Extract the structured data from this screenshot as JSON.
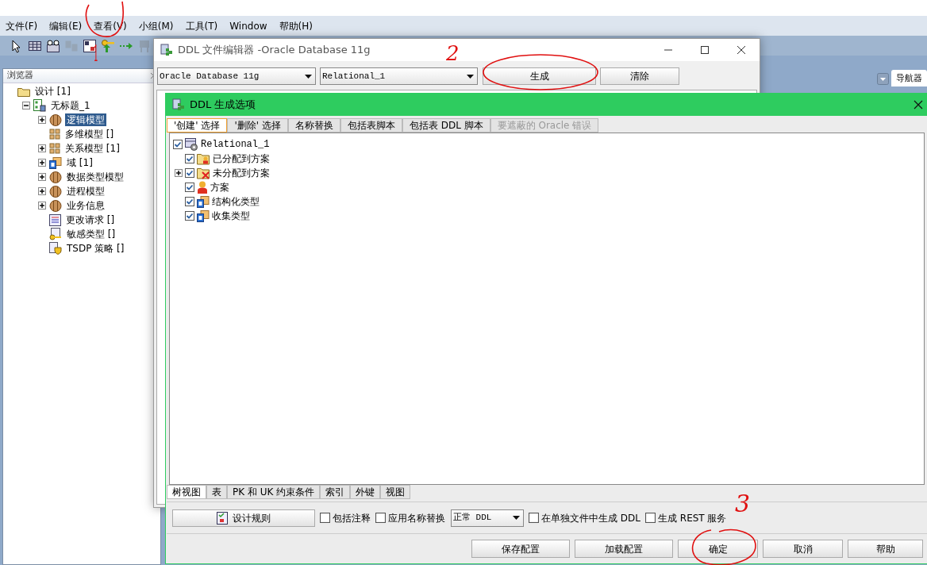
{
  "menu": [
    {
      "label": "文件(F)"
    },
    {
      "label": "编辑(E)"
    },
    {
      "label": "查看(V)"
    },
    {
      "label": "小组(M)"
    },
    {
      "label": "工具(T)"
    },
    {
      "label": "Window"
    },
    {
      "label": "帮助(H)"
    }
  ],
  "toolbar": [
    {
      "kind": "pointer",
      "disabled": false
    },
    {
      "kind": "table",
      "disabled": false
    },
    {
      "kind": "view",
      "disabled": false
    },
    {
      "kind": "split",
      "disabled": true
    },
    {
      "kind": "merge",
      "disabled": false
    },
    {
      "kind": "key",
      "disabled": false
    },
    {
      "kind": "arrow",
      "disabled": false
    },
    {
      "kind": "stool",
      "disabled": true
    }
  ],
  "browser": {
    "title": "浏览器",
    "tree": [
      {
        "label": "设计 [1]",
        "kind": "folder",
        "toggle": false,
        "selected": false,
        "children": [
          {
            "label": "无标题_1",
            "kind": "model",
            "toggle": true,
            "expanded": true,
            "selected": false,
            "children": [
              {
                "label": "逻辑模型",
                "kind": "cube",
                "toggle": true,
                "expanded": false,
                "selected": true
              },
              {
                "label": "多维模型 []",
                "kind": "grid",
                "toggle": false,
                "selected": false
              },
              {
                "label": "关系模型 [1]",
                "kind": "grid",
                "toggle": true,
                "expanded": false,
                "selected": false
              },
              {
                "label": "域 [1]",
                "kind": "domain",
                "toggle": true,
                "expanded": false,
                "selected": false
              },
              {
                "label": "数据类型模型",
                "kind": "cube",
                "toggle": true,
                "expanded": false,
                "selected": false
              },
              {
                "label": "进程模型",
                "kind": "cube",
                "toggle": true,
                "expanded": false,
                "selected": false
              },
              {
                "label": "业务信息",
                "kind": "cube",
                "toggle": true,
                "expanded": false,
                "selected": false
              },
              {
                "label": "更改请求 []",
                "kind": "list",
                "toggle": false,
                "selected": false
              },
              {
                "label": "敏感类型 []",
                "kind": "keydoc",
                "toggle": false,
                "selected": false
              },
              {
                "label": "TSDP 策略 []",
                "kind": "shielddoc",
                "toggle": false,
                "selected": false
              }
            ]
          }
        ]
      }
    ]
  },
  "navigator_tab": {
    "label": "导航器"
  },
  "editor": {
    "title": "DDL 文件编辑器 -Oracle Database 11g",
    "database_select": "Oracle Database 11g",
    "model_select": "Relational_1",
    "buttons": [
      {
        "label": "生成"
      },
      {
        "label": "清除"
      }
    ]
  },
  "dialog": {
    "title": "DDL 生成选项",
    "tabs": [
      {
        "label": "'创建' 选择",
        "selected": true,
        "disabled": false
      },
      {
        "label": "'删除' 选择",
        "selected": false,
        "disabled": false
      },
      {
        "label": "名称替换",
        "selected": false,
        "disabled": false
      },
      {
        "label": "包括表脚本",
        "selected": false,
        "disabled": false
      },
      {
        "label": "包括表 DDL 脚本",
        "selected": false,
        "disabled": false
      },
      {
        "label": "要遮蔽的 Oracle 错误",
        "selected": false,
        "disabled": true
      }
    ],
    "tree": [
      {
        "label": "Relational_1",
        "kind": "schema",
        "checked": true,
        "children": [
          {
            "label": "已分配到方案",
            "kind": "folder-user",
            "checked": true,
            "toggle": false
          },
          {
            "label": "未分配到方案",
            "kind": "folder-cross",
            "checked": true,
            "toggle": true,
            "expanded": false
          },
          {
            "label": "方案",
            "kind": "user",
            "checked": true,
            "toggle": false
          },
          {
            "label": "结构化类型",
            "kind": "folder-type",
            "checked": true,
            "toggle": false
          },
          {
            "label": "收集类型",
            "kind": "folder-type",
            "checked": true,
            "toggle": false
          }
        ]
      }
    ],
    "view_tabs": [
      {
        "label": "树视图",
        "selected": true
      },
      {
        "label": "表",
        "selected": false
      },
      {
        "label": "PK 和 UK 约束条件",
        "selected": false
      },
      {
        "label": "索引",
        "selected": false
      },
      {
        "label": "外键",
        "selected": false
      },
      {
        "label": "视图",
        "selected": false
      }
    ],
    "rules_button": "设计规则",
    "options": [
      {
        "kind": "checkbox",
        "label": "包括注释",
        "checked": false
      },
      {
        "kind": "checkbox",
        "label": "应用名称替换",
        "checked": false
      },
      {
        "kind": "select",
        "label": "正常 DDL"
      },
      {
        "kind": "checkbox",
        "label": "在单独文件中生成 DDL",
        "checked": false
      },
      {
        "kind": "checkbox",
        "label": "生成 REST 服务",
        "checked": false
      }
    ],
    "buttons": [
      {
        "label": "保存配置"
      },
      {
        "label": "加载配置"
      },
      {
        "label": "确定"
      },
      {
        "label": "取消"
      },
      {
        "label": "帮助"
      }
    ]
  },
  "annotations": [
    {
      "label": "1"
    },
    {
      "label": "2"
    },
    {
      "label": "3"
    }
  ]
}
